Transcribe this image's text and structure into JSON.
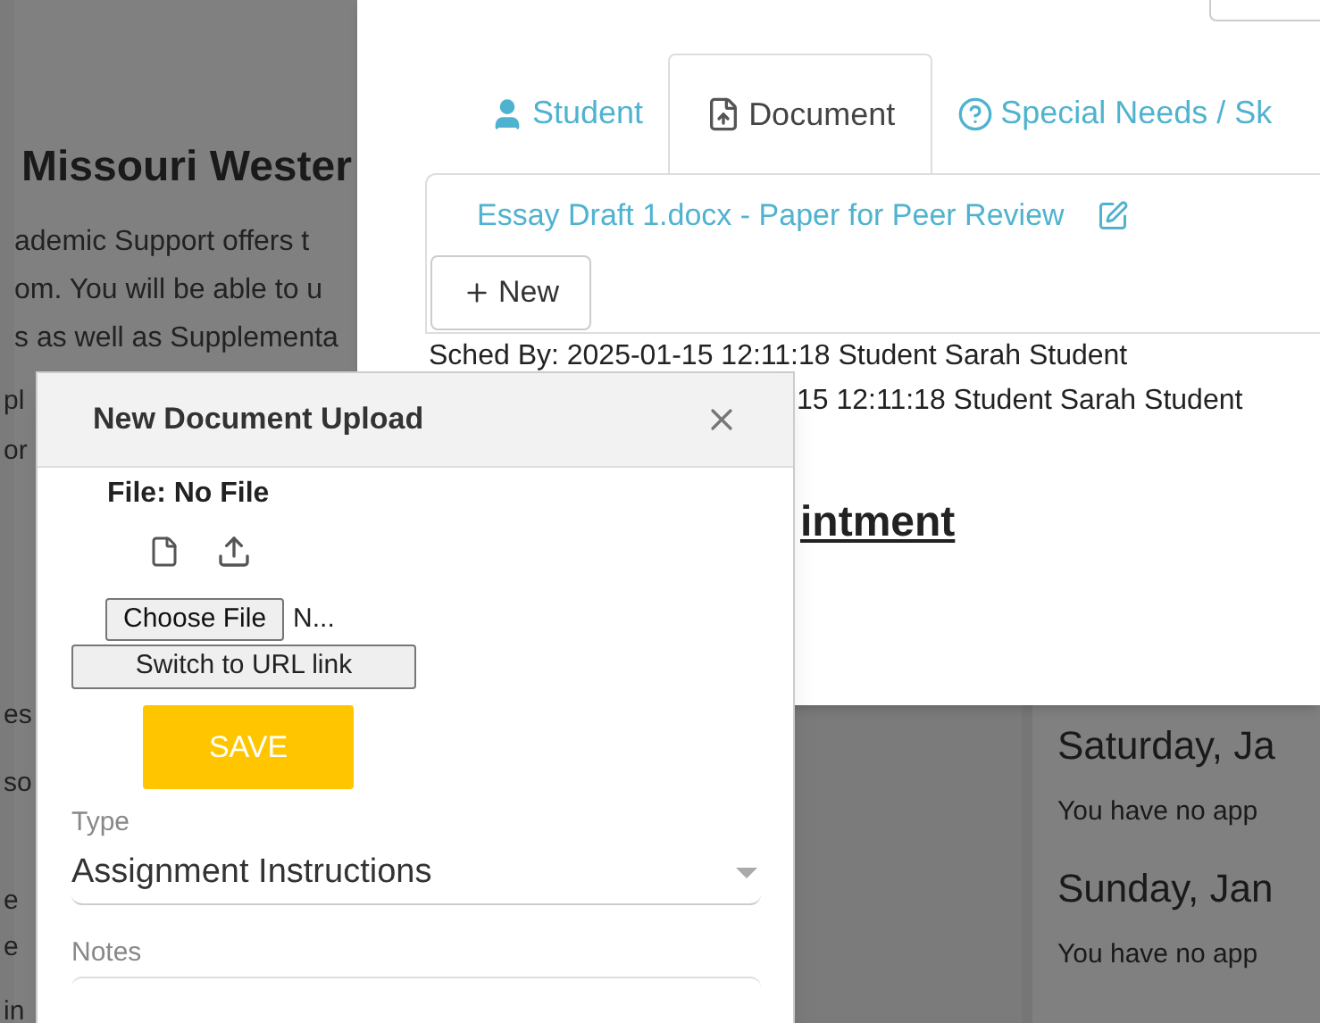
{
  "background_page": {
    "heading": "Missouri Wester",
    "intro_lines": [
      "ademic Support offers t",
      "om. You will be able to u",
      "s as well as Supplementa"
    ],
    "edge_fragments": [
      "pl",
      "or",
      "es",
      "so",
      "e",
      "e",
      "in"
    ],
    "days": [
      {
        "title": "Saturday, Ja",
        "message": "You have no app"
      },
      {
        "title": "Sunday, Jan",
        "message": "You have no app"
      }
    ]
  },
  "appointment_panel": {
    "tabs": [
      {
        "label": "Student",
        "kind": "person",
        "selected": false
      },
      {
        "label": "Document",
        "kind": "document",
        "selected": true
      },
      {
        "label": "Special Needs / Sk",
        "kind": "help",
        "selected": false
      }
    ],
    "document_link": "Essay Draft 1.docx - Paper for Peer Review",
    "new_button": "New",
    "sched_lines": [
      "Sched By: 2025-01-15 12:11:18 Student Sarah Student",
      "15 12:11:18 Student Sarah Student"
    ],
    "heading": "intment"
  },
  "upload_dialog": {
    "title": "New Document Upload",
    "file_label": "File: No File",
    "choose_file": "Choose File",
    "file_name": "N...",
    "switch_button": "Switch to URL link",
    "save_button": "SAVE",
    "type_label": "Type",
    "type_value": "Assignment Instructions",
    "notes_label": "Notes"
  }
}
